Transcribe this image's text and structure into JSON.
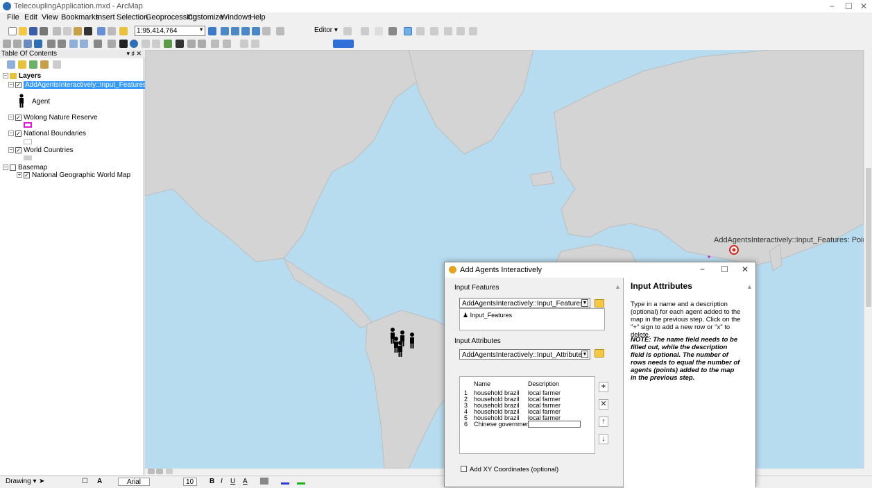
{
  "window": {
    "title": "TelecouplingApplication.mxd - ArcMap",
    "min": "−",
    "max": "☐",
    "close": "✕"
  },
  "menu": [
    "File",
    "Edit",
    "View",
    "Bookmarks",
    "Insert",
    "Selection",
    "Geoprocessing",
    "Customize",
    "Windows",
    "Help"
  ],
  "toolbar": {
    "scale": "1:95,414,764",
    "editor": "Editor ▾"
  },
  "toc": {
    "title": "Table Of Contents",
    "pin": "▾ ♯ ✕",
    "layers_root": "Layers",
    "layer1": "AddAgentsInteractively::Input_Features",
    "layer1_symbol": "Agent",
    "layer2": "Wolong Nature Reserve",
    "layer3": "National Boundaries",
    "layer4": "World Countries",
    "layer5": "Basemap",
    "layer5_child": "National Geographic World Map"
  },
  "map": {
    "point_label": "AddAgentsInteractively::Input_Features: Point"
  },
  "drawing": {
    "drawing_menu": "Drawing ▾",
    "font": "Arial",
    "size": "10",
    "bold": "B",
    "italic": "I",
    "underline": "U",
    "font_color": "A"
  },
  "dialog": {
    "title": "Add Agents Interactively",
    "input_features_label": "Input Features",
    "input_features_value": "AddAgentsInteractively::Input_Features",
    "features_list_item": "Input_Features",
    "input_attributes_label": "Input Attributes",
    "input_attributes_value": "AddAgentsInteractively::Input_Attributes",
    "table": {
      "columns": [
        "Name",
        "Description"
      ],
      "rows": [
        {
          "n": "1",
          "name": "household brazil",
          "desc": "local farmer"
        },
        {
          "n": "2",
          "name": "household brazil",
          "desc": "local farmer"
        },
        {
          "n": "3",
          "name": "household brazil",
          "desc": "local farmer"
        },
        {
          "n": "4",
          "name": "household brazil",
          "desc": "local farmer"
        },
        {
          "n": "5",
          "name": "household brazil",
          "desc": "local farmer"
        },
        {
          "n": "6",
          "name": "Chinese government",
          "desc": ""
        }
      ]
    },
    "buttons": {
      "add": "+",
      "delete": "✕",
      "up": "↑",
      "down": "↓"
    },
    "xy_label": "Add XY Coordinates (optional)",
    "help_title": "Input Attributes",
    "help_text": "Type in a name and a description (optional) for each agent added to the map in the previous step. Click on the \"+\" sign to add a new row or \"x\" to delete.",
    "help_note": "NOTE: The name field needs to be filled out, while the description field is optional. The number of rows needs to equal the number of agents (points) added to the map in the previous step."
  }
}
